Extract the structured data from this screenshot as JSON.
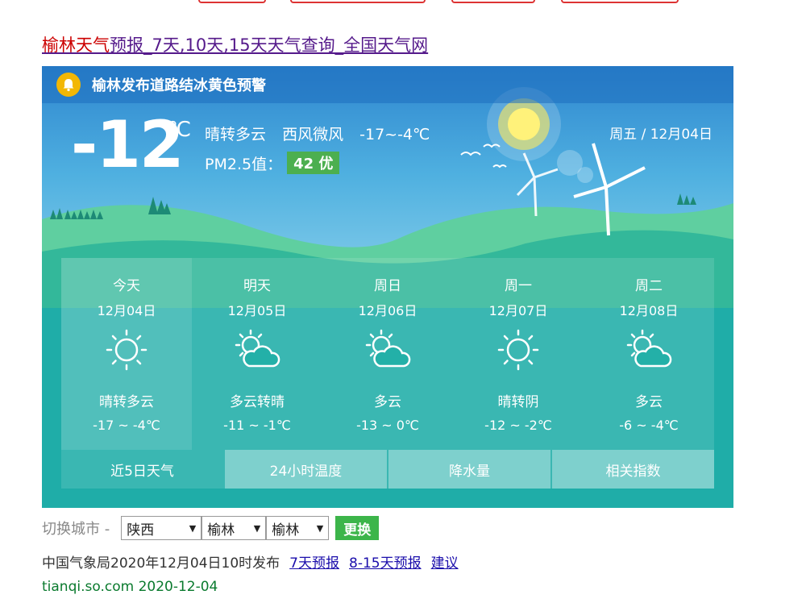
{
  "page": {
    "title_red": "榆林天气",
    "title_rest": "预报_7天,10天,15天天气查询_全国天气网"
  },
  "alert": {
    "text": "榆林发布道路结冰黄色预警"
  },
  "current": {
    "temp": "-12",
    "unit": "℃",
    "weather": "晴转多云",
    "wind": "西风微风",
    "range": "-17~-4℃",
    "pm_label": "PM2.5值：",
    "pm_value": "42 优",
    "date": "周五 / 12月04日"
  },
  "forecast": [
    {
      "name": "今天",
      "date": "12月04日",
      "icon": "sun-icon",
      "cond": "晴转多云",
      "range": "-17 ~ -4℃"
    },
    {
      "name": "明天",
      "date": "12月05日",
      "icon": "partly-cloudy-icon",
      "cond": "多云转晴",
      "range": "-11 ~ -1℃"
    },
    {
      "name": "周日",
      "date": "12月06日",
      "icon": "partly-cloudy-icon",
      "cond": "多云",
      "range": "-13 ~ 0℃"
    },
    {
      "name": "周一",
      "date": "12月07日",
      "icon": "sun-icon",
      "cond": "晴转阴",
      "range": "-12 ~ -2℃"
    },
    {
      "name": "周二",
      "date": "12月08日",
      "icon": "partly-cloudy-icon",
      "cond": "多云",
      "range": "-6 ~ -4℃"
    }
  ],
  "tabs": [
    "近5日天气",
    "24小时温度",
    "降水量",
    "相关指数"
  ],
  "switcher": {
    "label": "切换城市 -",
    "province": "陕西",
    "city": "榆林",
    "county": "榆林",
    "button": "更换"
  },
  "publish": {
    "text": "中国气象局2020年12月04日10时发布",
    "link_7": "7天预报",
    "link_15": "8-15天预报",
    "link_suggest": "建议"
  },
  "source": {
    "url": "tianqi.so.com  2020-12-04"
  },
  "colors": {
    "widget_bg": "#1fada8",
    "alert_bell": "#f2b705",
    "pm_good": "#4caf50",
    "change_button": "#3cb54a"
  }
}
